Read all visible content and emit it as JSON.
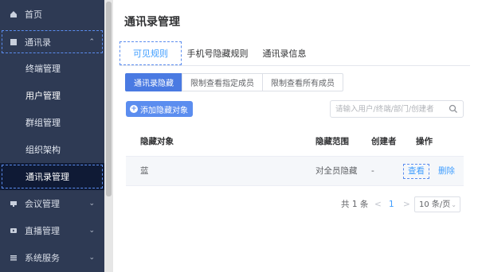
{
  "sidebar": {
    "items": [
      {
        "label": "首页",
        "icon": "home-icon"
      },
      {
        "label": "通讯录",
        "icon": "contacts-icon",
        "expanded": true,
        "children": [
          "终端管理",
          "用户管理",
          "群组管理",
          "组织架构",
          "通讯录管理"
        ],
        "active_child": "通讯录管理"
      },
      {
        "label": "会议管理",
        "icon": "meeting-icon"
      },
      {
        "label": "直播管理",
        "icon": "live-icon"
      },
      {
        "label": "系统服务",
        "icon": "service-icon"
      }
    ]
  },
  "main": {
    "title": "通讯录管理",
    "tabs": [
      {
        "label": "可见规则",
        "active": true
      },
      {
        "label": "手机号隐藏规则",
        "active": false
      },
      {
        "label": "通讯录信息",
        "active": false
      }
    ],
    "segments": [
      {
        "label": "通讯录隐藏",
        "active": true
      },
      {
        "label": "限制查看指定成员",
        "active": false
      },
      {
        "label": "限制查看所有成员",
        "active": false
      }
    ],
    "add_button": "添加隐藏对象",
    "search_placeholder": "请输入用户/终端/部门/创建者",
    "table": {
      "headers": [
        "隐藏对象",
        "隐藏范围",
        "创建者",
        "操作"
      ],
      "rows": [
        {
          "object": "蓝",
          "scope": "对全员隐藏",
          "creator": "-",
          "view": "查看",
          "delete": "删除"
        }
      ]
    },
    "pagination": {
      "total": "共 1 条",
      "prev": "<",
      "page": "1",
      "next": ">",
      "page_size": "10 条/页"
    }
  },
  "colors": {
    "sidebar_bg": "#2e3a54",
    "sidebar_active": "#0f1a35",
    "primary": "#409eff",
    "button": "#5b8def"
  }
}
